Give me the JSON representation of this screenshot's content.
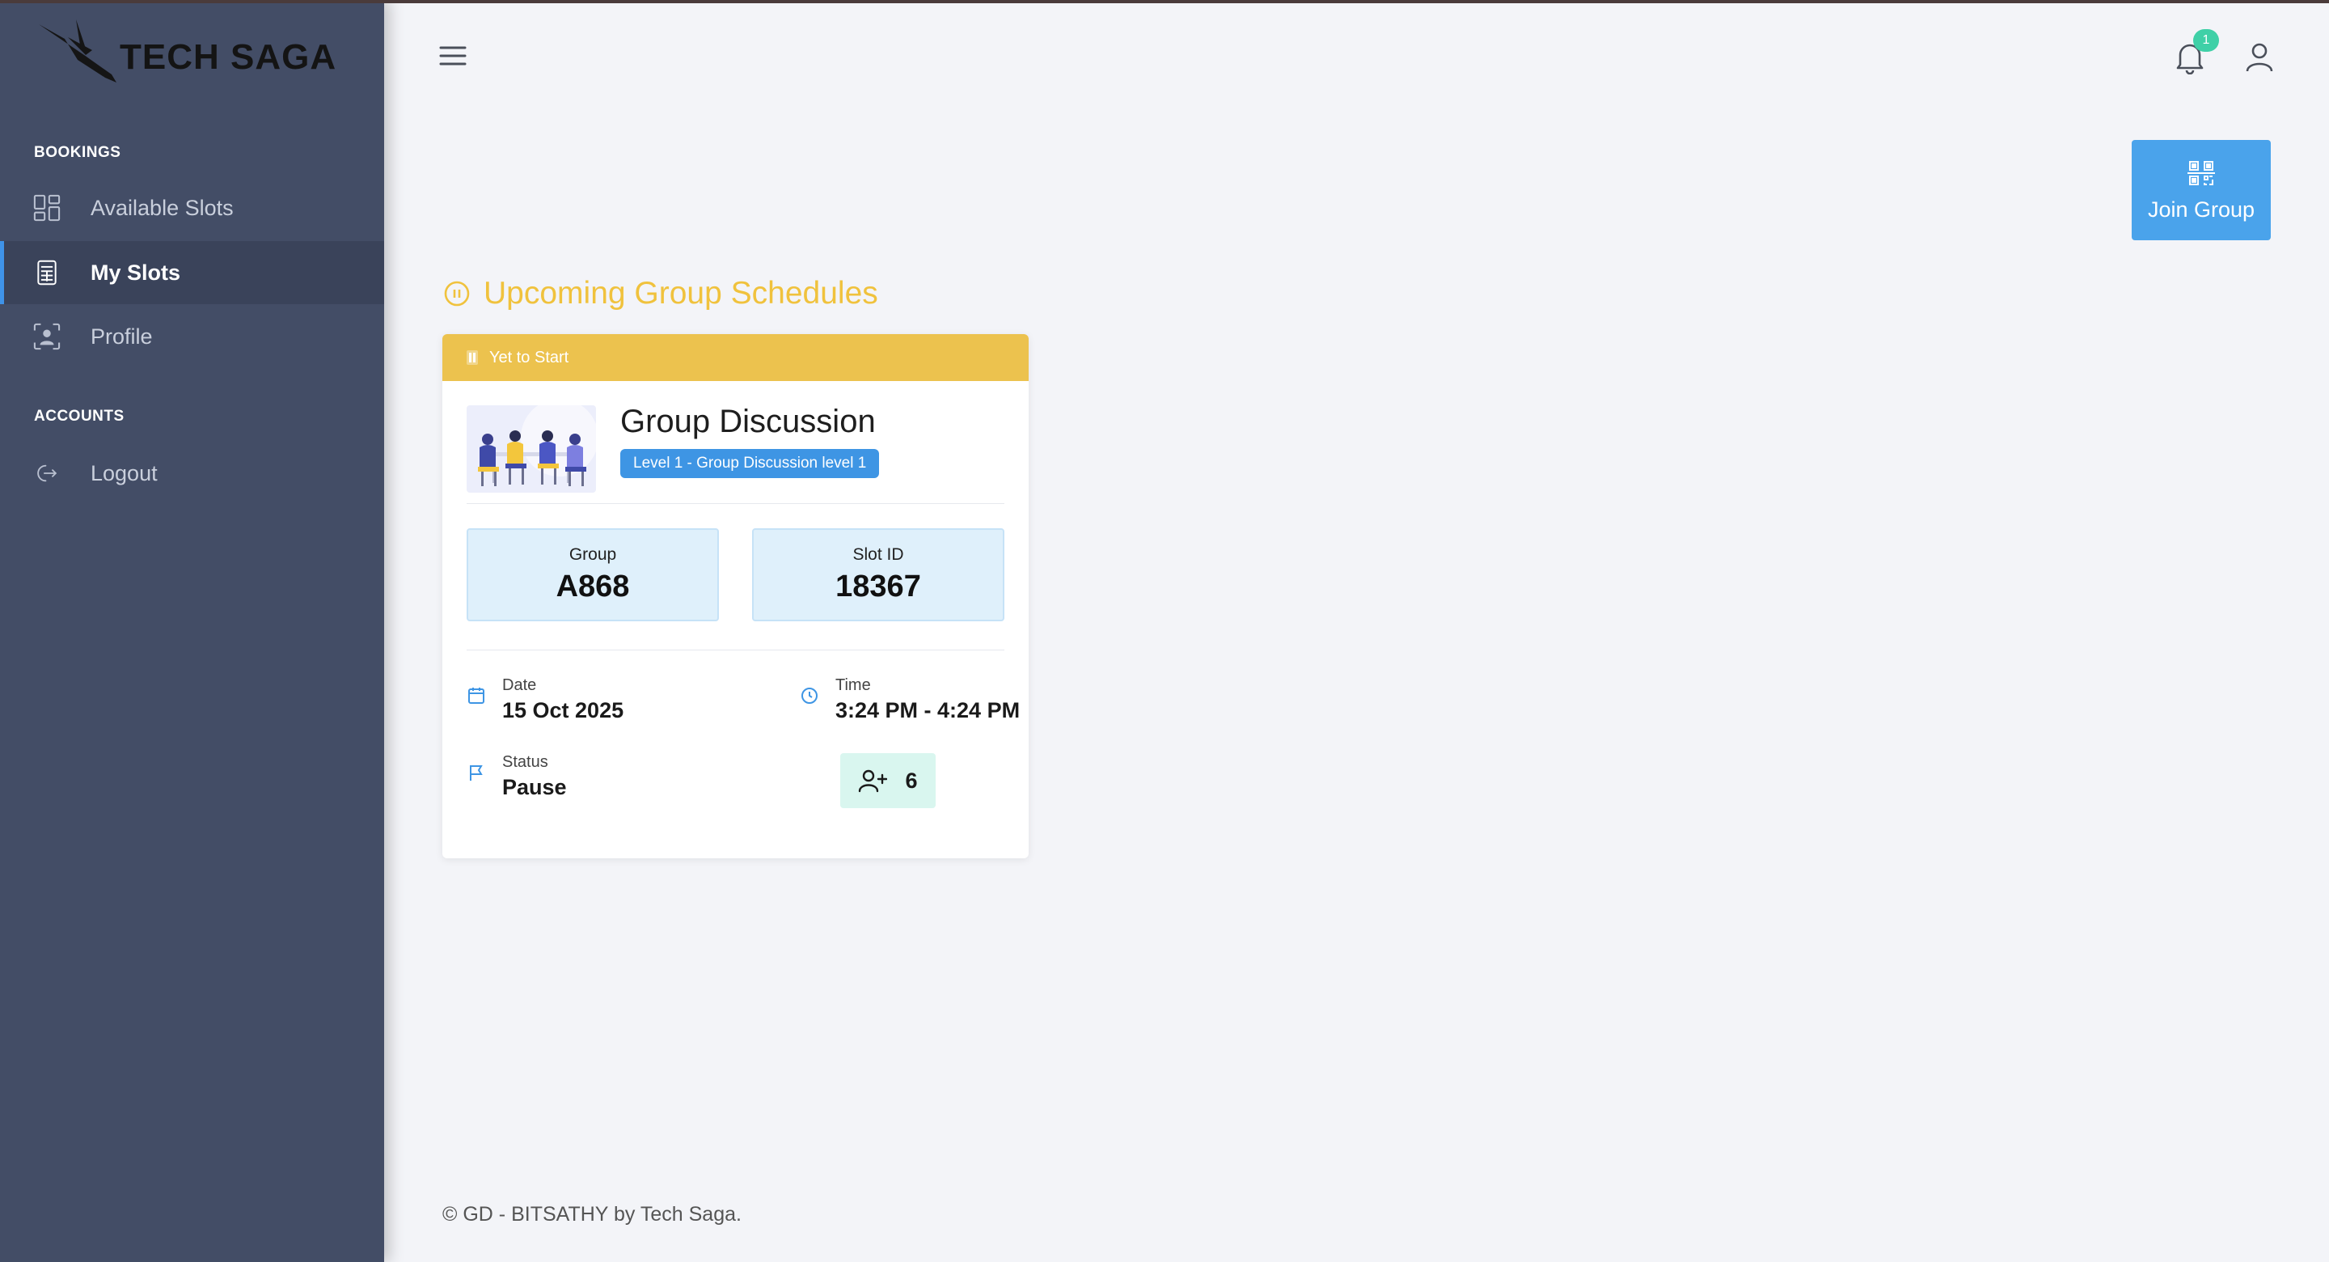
{
  "brand": {
    "name": "TECH SAGA"
  },
  "sidebar": {
    "sections": [
      {
        "header": "BOOKINGS"
      },
      {
        "header": "ACCOUNTS"
      }
    ],
    "items": [
      {
        "label": "Available Slots",
        "icon": "grid-icon",
        "active": false
      },
      {
        "label": "My Slots",
        "icon": "calculator-icon",
        "active": true
      },
      {
        "label": "Profile",
        "icon": "profile-scan-icon",
        "active": false
      },
      {
        "label": "Logout",
        "icon": "logout-icon",
        "active": false
      }
    ]
  },
  "topbar": {
    "notification_count": "1",
    "menu_icon": "hamburger-icon",
    "bell_icon": "bell-icon",
    "user_icon": "user-icon"
  },
  "join_group": {
    "label": "Join Group",
    "icon": "qr-code-icon"
  },
  "section": {
    "title": "Upcoming Group Schedules",
    "icon": "pause-circle-icon"
  },
  "card": {
    "status": "Yet to Start",
    "title": "Group Discussion",
    "level": "Level 1 - Group Discussion level 1",
    "group_label": "Group",
    "group_value": "A868",
    "slot_label": "Slot ID",
    "slot_value": "18367",
    "date_label": "Date",
    "date_value": "15 Oct 2025",
    "time_label": "Time",
    "time_value": "3:24 PM - 4:24 PM",
    "status_label": "Status",
    "status_value": "Pause",
    "members_count": "6"
  },
  "footer": {
    "text": "© GD - BITSATHY by Tech Saga."
  },
  "colors": {
    "sidebar_bg": "#434d66",
    "accent_blue": "#4aa3eb",
    "status_yellow": "#ecc24e",
    "title_yellow": "#f0c23d",
    "badge_green": "#3fd0a7"
  }
}
